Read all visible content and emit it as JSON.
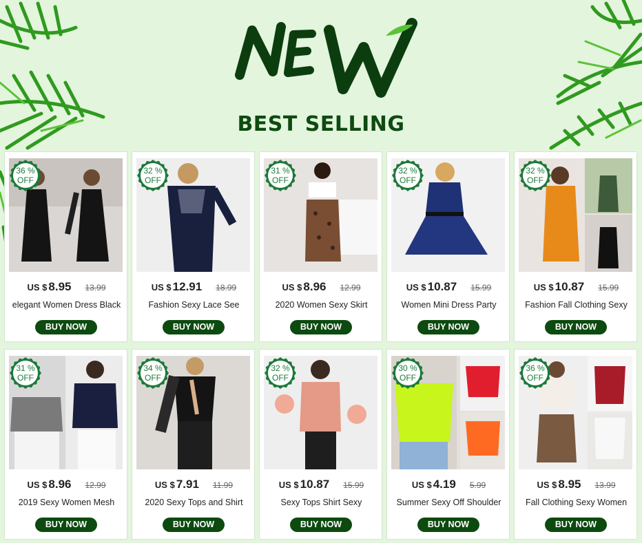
{
  "banner": {
    "logo_text": "NEW",
    "heading": "BEST SELLING"
  },
  "colors": {
    "background": "#e3f5dc",
    "heading": "#0e4a12",
    "button": "#0d4a10",
    "badge": "#1c7a3a"
  },
  "products": [
    {
      "discount": "36 %",
      "off": "OFF",
      "currency": "US $",
      "price": "8.95",
      "old_price": "13.99",
      "title": "elegant Women Dress Black",
      "button": "BUY NOW",
      "image": "black-dress-photo"
    },
    {
      "discount": "32 %",
      "off": "OFF",
      "currency": "US $",
      "price": "12.91",
      "old_price": "18.99",
      "title": "Fashion Sexy Lace See",
      "button": "BUY NOW",
      "image": "navy-lace-dress-photo"
    },
    {
      "discount": "31 %",
      "off": "OFF",
      "currency": "US $",
      "price": "8.96",
      "old_price": "12.99",
      "title": "2020 Women Sexy Skirt",
      "button": "BUY NOW",
      "image": "leopard-skirt-photo"
    },
    {
      "discount": "32 %",
      "off": "OFF",
      "currency": "US $",
      "price": "10.87",
      "old_price": "15.99",
      "title": "Women Mini Dress Party",
      "button": "BUY NOW",
      "image": "blue-mini-dress-photo"
    },
    {
      "discount": "32 %",
      "off": "OFF",
      "currency": "US $",
      "price": "10.87",
      "old_price": "15.99",
      "title": "Fashion Fall Clothing Sexy",
      "button": "BUY NOW",
      "image": "orange-bodycon-dress-photo"
    },
    {
      "discount": "31 %",
      "off": "OFF",
      "currency": "US $",
      "price": "8.96",
      "old_price": "12.99",
      "title": "2019 Sexy Women Mesh",
      "button": "BUY NOW",
      "image": "mesh-top-photo"
    },
    {
      "discount": "34 %",
      "off": "OFF",
      "currency": "US $",
      "price": "7.91",
      "old_price": "11.99",
      "title": "2020 Sexy Tops and Shirt",
      "button": "BUY NOW",
      "image": "black-bodysuit-photo"
    },
    {
      "discount": "32 %",
      "off": "OFF",
      "currency": "US $",
      "price": "10.87",
      "old_price": "15.99",
      "title": "Sexy Tops Shirt Sexy",
      "button": "BUY NOW",
      "image": "pink-top-photo"
    },
    {
      "discount": "30 %",
      "off": "OFF",
      "currency": "US $",
      "price": "4.19",
      "old_price": "5.99",
      "title": "Summer Sexy Off Shoulder",
      "button": "BUY NOW",
      "image": "neon-tshirt-photo"
    },
    {
      "discount": "36 %",
      "off": "OFF",
      "currency": "US $",
      "price": "8.95",
      "old_price": "13.99",
      "title": "Fall Clothing Sexy Women",
      "button": "BUY NOW",
      "image": "crop-top-skirt-photo"
    }
  ]
}
